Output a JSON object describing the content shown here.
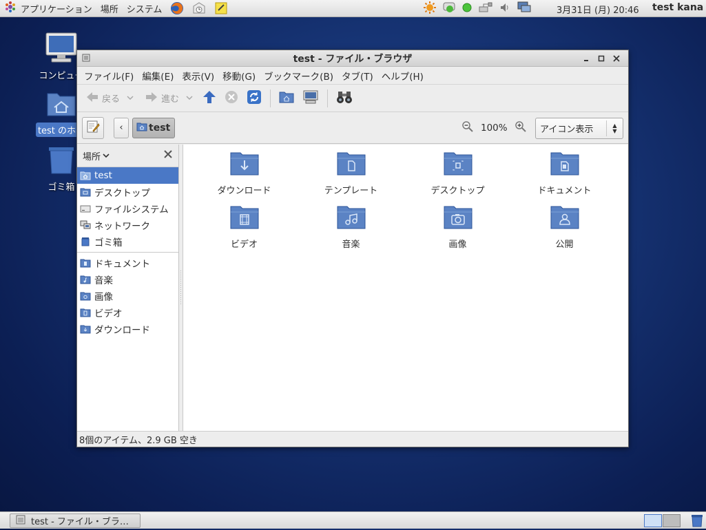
{
  "top_panel": {
    "menus": [
      "アプリケーション",
      "場所",
      "システム"
    ],
    "clock": "3月31日 (月) 20:46",
    "user": "test kana"
  },
  "desktop": {
    "icons": [
      {
        "label": "コンピュー"
      },
      {
        "label": "test のホー"
      },
      {
        "label": "ゴミ箱"
      }
    ]
  },
  "window": {
    "title": "test - ファイル・ブラウザ",
    "menubar": [
      "ファイル(F)",
      "編集(E)",
      "表示(V)",
      "移動(G)",
      "ブックマーク(B)",
      "タブ(T)",
      "ヘルプ(H)"
    ],
    "toolbar": {
      "back": "戻る",
      "forward": "進む"
    },
    "location": {
      "crumb": "test",
      "back_glyph": "‹",
      "zoom": "100%",
      "view_mode": "アイコン表示"
    },
    "sidebar": {
      "header": "場所",
      "places": [
        "test",
        "デスクトップ",
        "ファイルシステム",
        "ネットワーク",
        "ゴミ箱"
      ],
      "bookmarks": [
        "ドキュメント",
        "音楽",
        "画像",
        "ビデオ",
        "ダウンロード"
      ]
    },
    "files": [
      {
        "label": "ダウンロード",
        "icon": "download"
      },
      {
        "label": "テンプレート",
        "icon": "template"
      },
      {
        "label": "デスクトップ",
        "icon": "desktop"
      },
      {
        "label": "ドキュメント",
        "icon": "document"
      },
      {
        "label": "ビデオ",
        "icon": "video"
      },
      {
        "label": "音楽",
        "icon": "music"
      },
      {
        "label": "画像",
        "icon": "picture"
      },
      {
        "label": "公開",
        "icon": "public"
      }
    ],
    "status": "8個のアイテム、2.9 GB 空き"
  },
  "taskbar": {
    "task_label": "test - ファイル・ブラ…"
  },
  "colors": {
    "selection": "#4a78c6",
    "folder": "#5b83c4",
    "desktop_bg": "#163373"
  }
}
